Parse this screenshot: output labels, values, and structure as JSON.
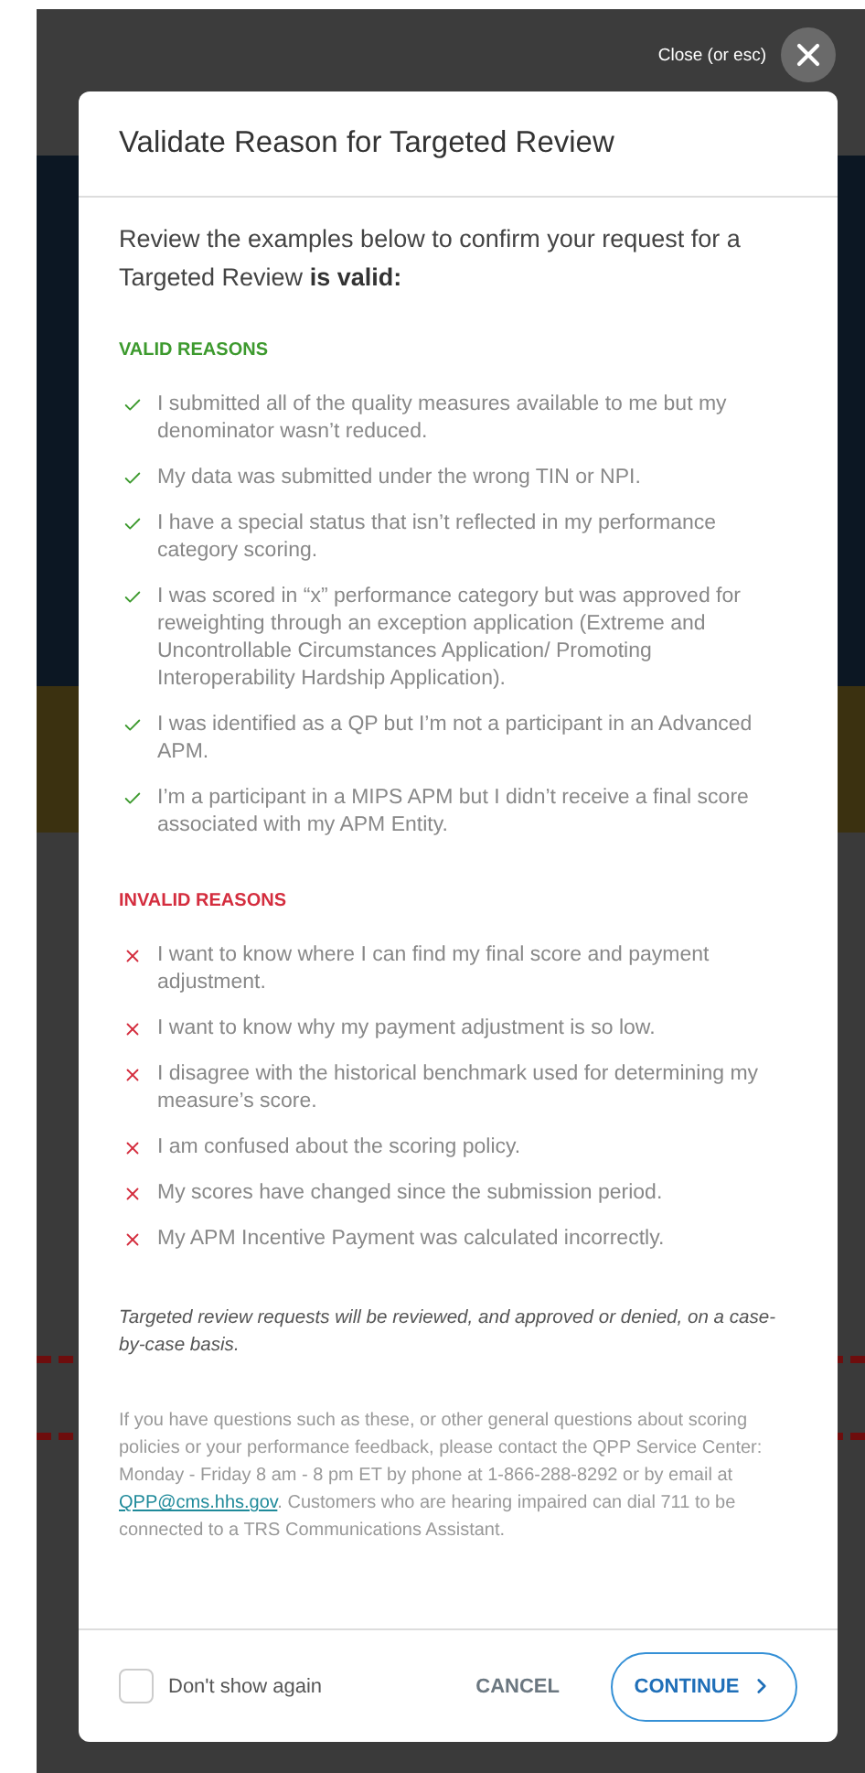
{
  "close": {
    "label": "Close (or esc)"
  },
  "modal": {
    "title": "Validate Reason for Targeted Review",
    "intro": "Review the examples below to confirm your request for a Targeted Review **is valid:**",
    "sections": [
      {
        "kind": "valid",
        "heading": "VALID REASONS",
        "items": [
          "I submitted all of the quality measures available to me but my denominator wasn’t reduced.",
          "My data was submitted under the wrong TIN or NPI.",
          "I have a special status that isn’t reflected in my performance category scoring.",
          "I was scored in “x” performance category but was approved for reweighting through an exception application (Extreme and Uncontrollable Circumstances Application/ Promoting Interoperability Hardship Application).",
          "I was identified as a QP but I’m not a participant in an Advanced APM.",
          "I’m a participant in a MIPS APM but I didn’t receive a final score associated with my APM Entity."
        ]
      },
      {
        "kind": "invalid",
        "heading": "INVALID REASONS",
        "items": [
          "I want to know where I can find my final score and payment adjustment.",
          "I want to know why my payment adjustment is so low.",
          "I disagree with the historical benchmark used for determining my measure’s score.",
          "I am confused about the scoring policy.",
          "My scores have changed since the submission period.",
          "My APM Incentive Payment was calculated incorrectly."
        ]
      }
    ],
    "note": "Targeted review requests will be reviewed, and approved or denied, on a case-by-case basis.",
    "contact": {
      "before": "If you have questions such as these, or other general questions about scoring policies or your performance feedback, please contact the QPP Service Center: Monday - Friday 8 am - 8 pm ET by phone at 1-866-288-8292 or by email at ",
      "link": "QPP@cms.hhs.gov",
      "after": ". Customers who are hearing impaired can dial 711 to be connected to a TRS Communications Assistant."
    },
    "footer": {
      "checkbox": {
        "label": "Don't show again",
        "checked": false
      },
      "cancel": "CANCEL",
      "continue": "CONTINUE"
    }
  }
}
